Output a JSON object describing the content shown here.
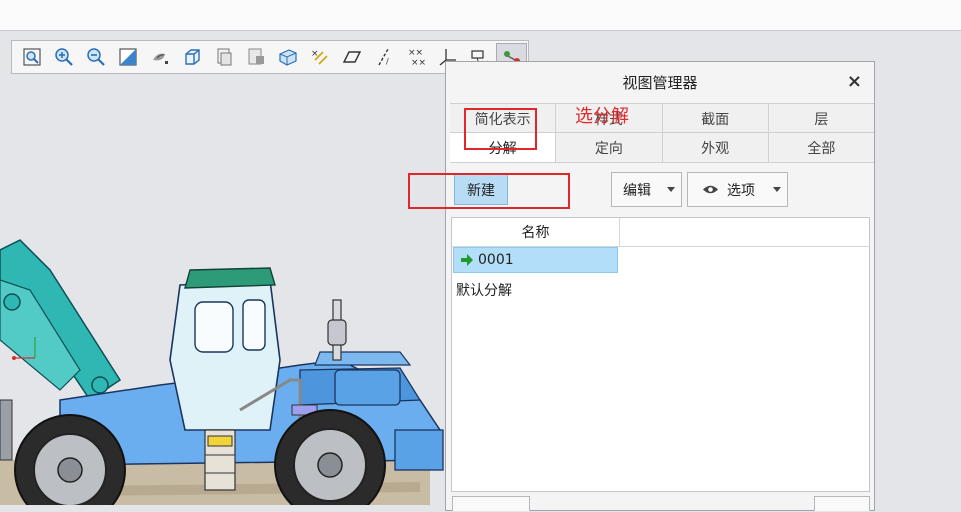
{
  "toolbar": {
    "icons": [
      "zoom-fit-icon",
      "zoom-in-icon",
      "zoom-out-icon",
      "repaint-icon",
      "display-style-icon",
      "saved-orientation-icon",
      "view-manager-icon",
      "section-icon",
      "perspective-icon",
      "datum-display-icon",
      "plane-display-icon",
      "axis-display-icon",
      "point-display-icon",
      "csys-display-icon",
      "annotation-display-icon",
      "spin-center-icon"
    ]
  },
  "dialog": {
    "title": "视图管理器",
    "close": "×",
    "tabs_row1": [
      "简化表示",
      "样式",
      "截面",
      "层"
    ],
    "tabs_row2": [
      "分解",
      "定向",
      "外观",
      "全部"
    ],
    "selected_tab": "分解",
    "new_button": "新建",
    "edit_button": "编辑",
    "options_button": "选项",
    "column_header": "名称",
    "rows": [
      {
        "name": "0001",
        "active": true
      },
      {
        "name": "默认分解",
        "active": false
      }
    ]
  },
  "annotation": {
    "text": "选分解",
    "color": "#e0282a"
  },
  "colors": {
    "selection": "#b3def9",
    "vehicle_body": "#6aaeef",
    "boom": "#2fb7b3"
  }
}
